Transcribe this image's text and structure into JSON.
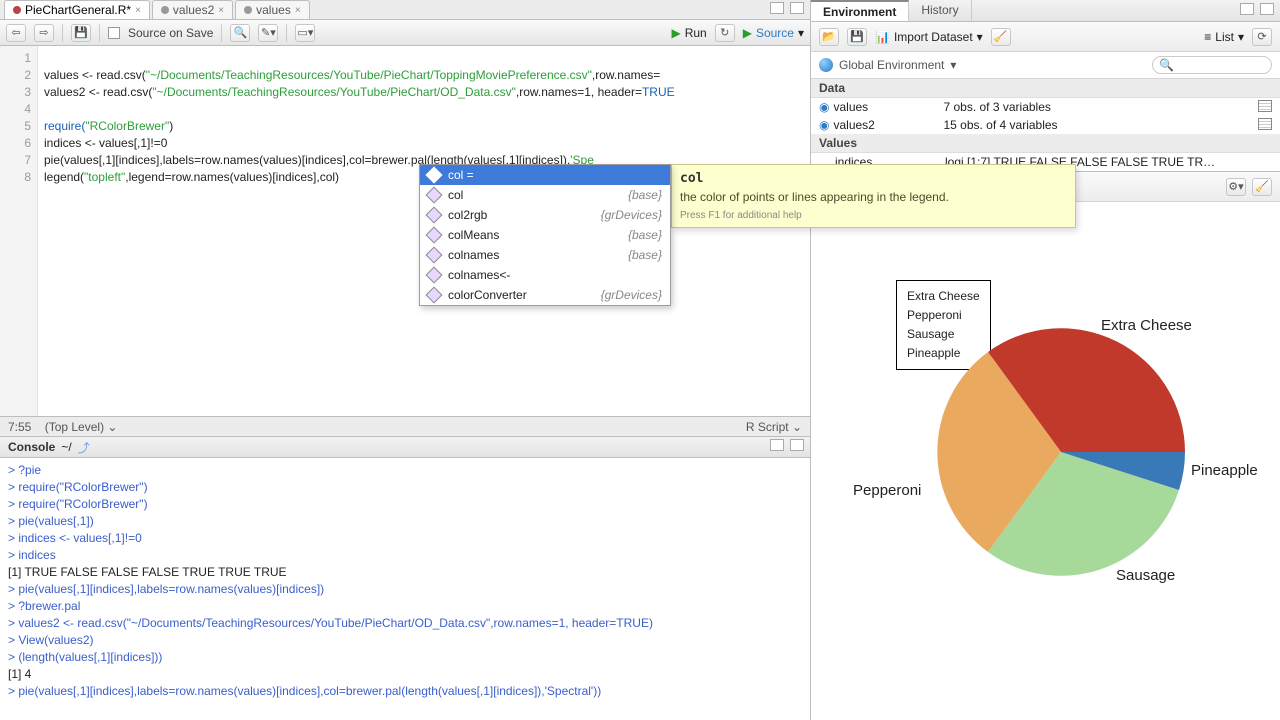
{
  "editor": {
    "tabs": [
      {
        "name": "PieChartGeneral.R*",
        "active": true,
        "dirty": true
      },
      {
        "name": "values2",
        "active": false
      },
      {
        "name": "values",
        "active": false
      }
    ],
    "toolbar": {
      "source_on_save": "Source on Save",
      "run": "Run",
      "source": "Source"
    },
    "gutter": [
      "1",
      "2",
      "3",
      "4",
      "5",
      "6",
      "7",
      "8"
    ],
    "lines": {
      "l1a": "values <- read.csv(",
      "l1b": "\"~/Documents/TeachingResources/YouTube/PieChart/ToppingMoviePreference.csv\"",
      "l1c": ",row.names=",
      "l2a": "values2 <- read.csv(",
      "l2b": "\"~/Documents/TeachingResources/YouTube/PieChart/OD_Data.csv\"",
      "l2c": ",row.names=1, header=",
      "l2d": "TRUE",
      "l4a": "require(",
      "l4b": "\"RColorBrewer\"",
      "l4c": ")",
      "l5a": "indices <- values[,1]!=0",
      "l6a": "pie(values[,1][indices],labels=row.names(values)[indices],col=brewer.pal(length(values[,1][indices]),",
      "l6b": "'Spe",
      "l7a": "legend(",
      "l7b": "\"topleft\"",
      "l7c": ",legend=row.names(values)[indices],col)"
    },
    "status": {
      "pos": "7:55",
      "scope": "(Top Level) ",
      "lang": "R Script "
    }
  },
  "autocomplete": {
    "items": [
      {
        "label": "col = ",
        "pkg": "",
        "sel": true
      },
      {
        "label": "col",
        "pkg": "{base}"
      },
      {
        "label": "col2rgb",
        "pkg": "{grDevices}"
      },
      {
        "label": "colMeans",
        "pkg": "{base}"
      },
      {
        "label": "colnames",
        "pkg": "{base}"
      },
      {
        "label": "colnames<-",
        "pkg": ""
      },
      {
        "label": "colorConverter",
        "pkg": "{grDevices}"
      }
    ],
    "tooltip": {
      "name": "col",
      "desc": "the color of points or lines appearing in the legend.",
      "foot": "Press F1 for additional help"
    }
  },
  "console": {
    "title": "Console",
    "cwd": "~/",
    "lines": [
      "> ?pie",
      "> require(\"RColorBrewer\")",
      "> require(\"RColorBrewer\")",
      "> pie(values[,1])",
      "> indices <- values[,1]!=0",
      "> indices",
      "[1]  TRUE FALSE FALSE FALSE  TRUE  TRUE  TRUE",
      "> pie(values[,1][indices],labels=row.names(values)[indices])",
      "> ?brewer.pal",
      "> values2 <- read.csv(\"~/Documents/TeachingResources/YouTube/PieChart/OD_Data.csv\",row.names=1, header=TRUE)",
      "> View(values2)",
      "> (length(values[,1][indices]))",
      "[1] 4",
      "> pie(values[,1][indices],labels=row.names(values)[indices],col=brewer.pal(length(values[,1][indices]),'Spectral'))"
    ]
  },
  "env": {
    "tabs": [
      "Environment",
      "History"
    ],
    "import": "Import Dataset",
    "list": "List",
    "scope": "Global Environment",
    "section_data": "Data",
    "section_values": "Values",
    "rows": [
      {
        "name": "values",
        "desc": "7 obs. of 3 variables",
        "play": true,
        "grid": true
      },
      {
        "name": "values2",
        "desc": "15 obs. of 4 variables",
        "play": true,
        "grid": true
      }
    ],
    "vals": [
      {
        "name": "indices",
        "desc": "logi [1:7] TRUE FALSE FALSE FALSE TRUE TR…"
      }
    ]
  },
  "plot": {
    "legend": [
      "Extra Cheese",
      "Pepperoni",
      "Sausage",
      "Pineapple"
    ],
    "labels": {
      "extra": "Extra Cheese",
      "pine": "Pineapple",
      "sausage": "Sausage",
      "pepperoni": "Pepperoni"
    }
  },
  "chart_data": {
    "type": "pie",
    "title": "",
    "categories": [
      "Extra Cheese",
      "Pepperoni",
      "Sausage",
      "Pineapple"
    ],
    "values": [
      35,
      27,
      30,
      8
    ],
    "colors": [
      "#c0392b",
      "#e9a95e",
      "#a6d99a",
      "#3a79b7"
    ],
    "legend_position": "topleft"
  }
}
